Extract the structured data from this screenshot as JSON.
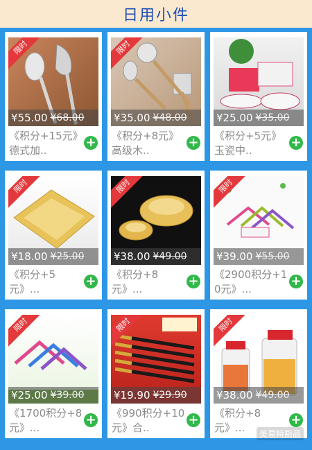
{
  "header": {
    "title": "日用小件"
  },
  "badge_label": "限时",
  "products": [
    {
      "price": "¥55.00",
      "old_price": "¥68.00",
      "name": "《积分+15元》德式加..",
      "image": "spoon-and-skimmer"
    },
    {
      "price": "¥35.00",
      "old_price": "¥48.00",
      "name": "《积分+8元》高级木..",
      "image": "kitchen-utensils"
    },
    {
      "price": "¥25.00",
      "old_price": "¥35.00",
      "name": "《积分+5元》玉瓷中..",
      "image": "food-containers"
    },
    {
      "price": "¥18.00",
      "old_price": "¥25.00",
      "name": "《积分+5元》...",
      "image": "golden-plate"
    },
    {
      "price": "¥38.00",
      "old_price": "¥49.00",
      "name": "《积分+8元》...",
      "image": "golden-bowls"
    },
    {
      "price": "¥39.00",
      "old_price": "¥55.00",
      "name": "《2900积分+10元》...",
      "image": "clothes-hangers"
    },
    {
      "price": "¥25.00",
      "old_price": "¥39.00",
      "name": "《1700积分+8元》...",
      "image": "colorful-hangers"
    },
    {
      "price": "¥19.90",
      "old_price": "¥29.90",
      "name": "《990积分+10元》合..",
      "image": "chopsticks"
    },
    {
      "price": "¥38.00",
      "old_price": "¥49.00",
      "name": "《积分+8元》...",
      "image": "oil-bottles"
    }
  ],
  "add_symbol": "+",
  "watermark": "美易特厨品"
}
